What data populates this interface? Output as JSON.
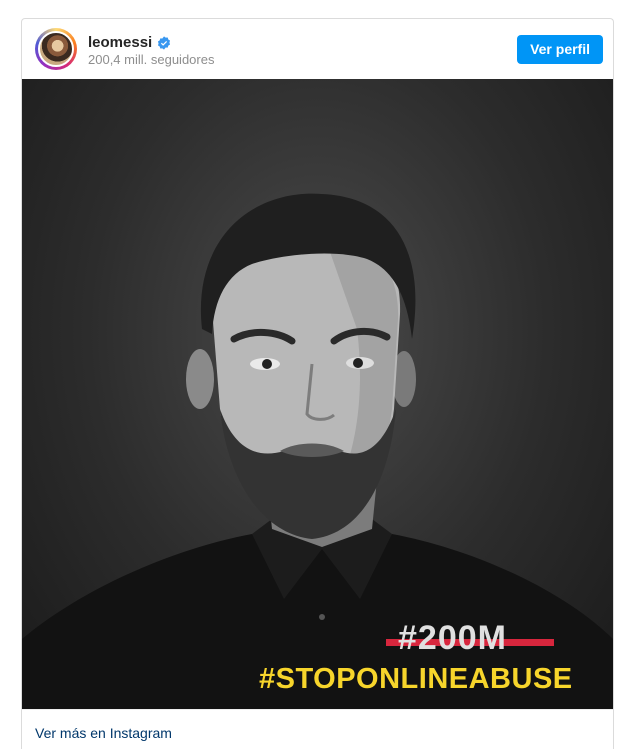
{
  "header": {
    "username": "leomessi",
    "followers": "200,4 mill. seguidores",
    "profile_button": "Ver perfil",
    "verified_icon": "verified-badge-icon"
  },
  "post": {
    "overlay_strikethrough_text": "#200M",
    "overlay_hashtag": "#STOPONLINEABUSE"
  },
  "footer": {
    "more_link": "Ver más en Instagram"
  },
  "colors": {
    "button_blue": "#0095f6",
    "hashtag_yellow": "#f7d52b",
    "strike_red": "#d7263d",
    "link_blue": "#00376b"
  }
}
